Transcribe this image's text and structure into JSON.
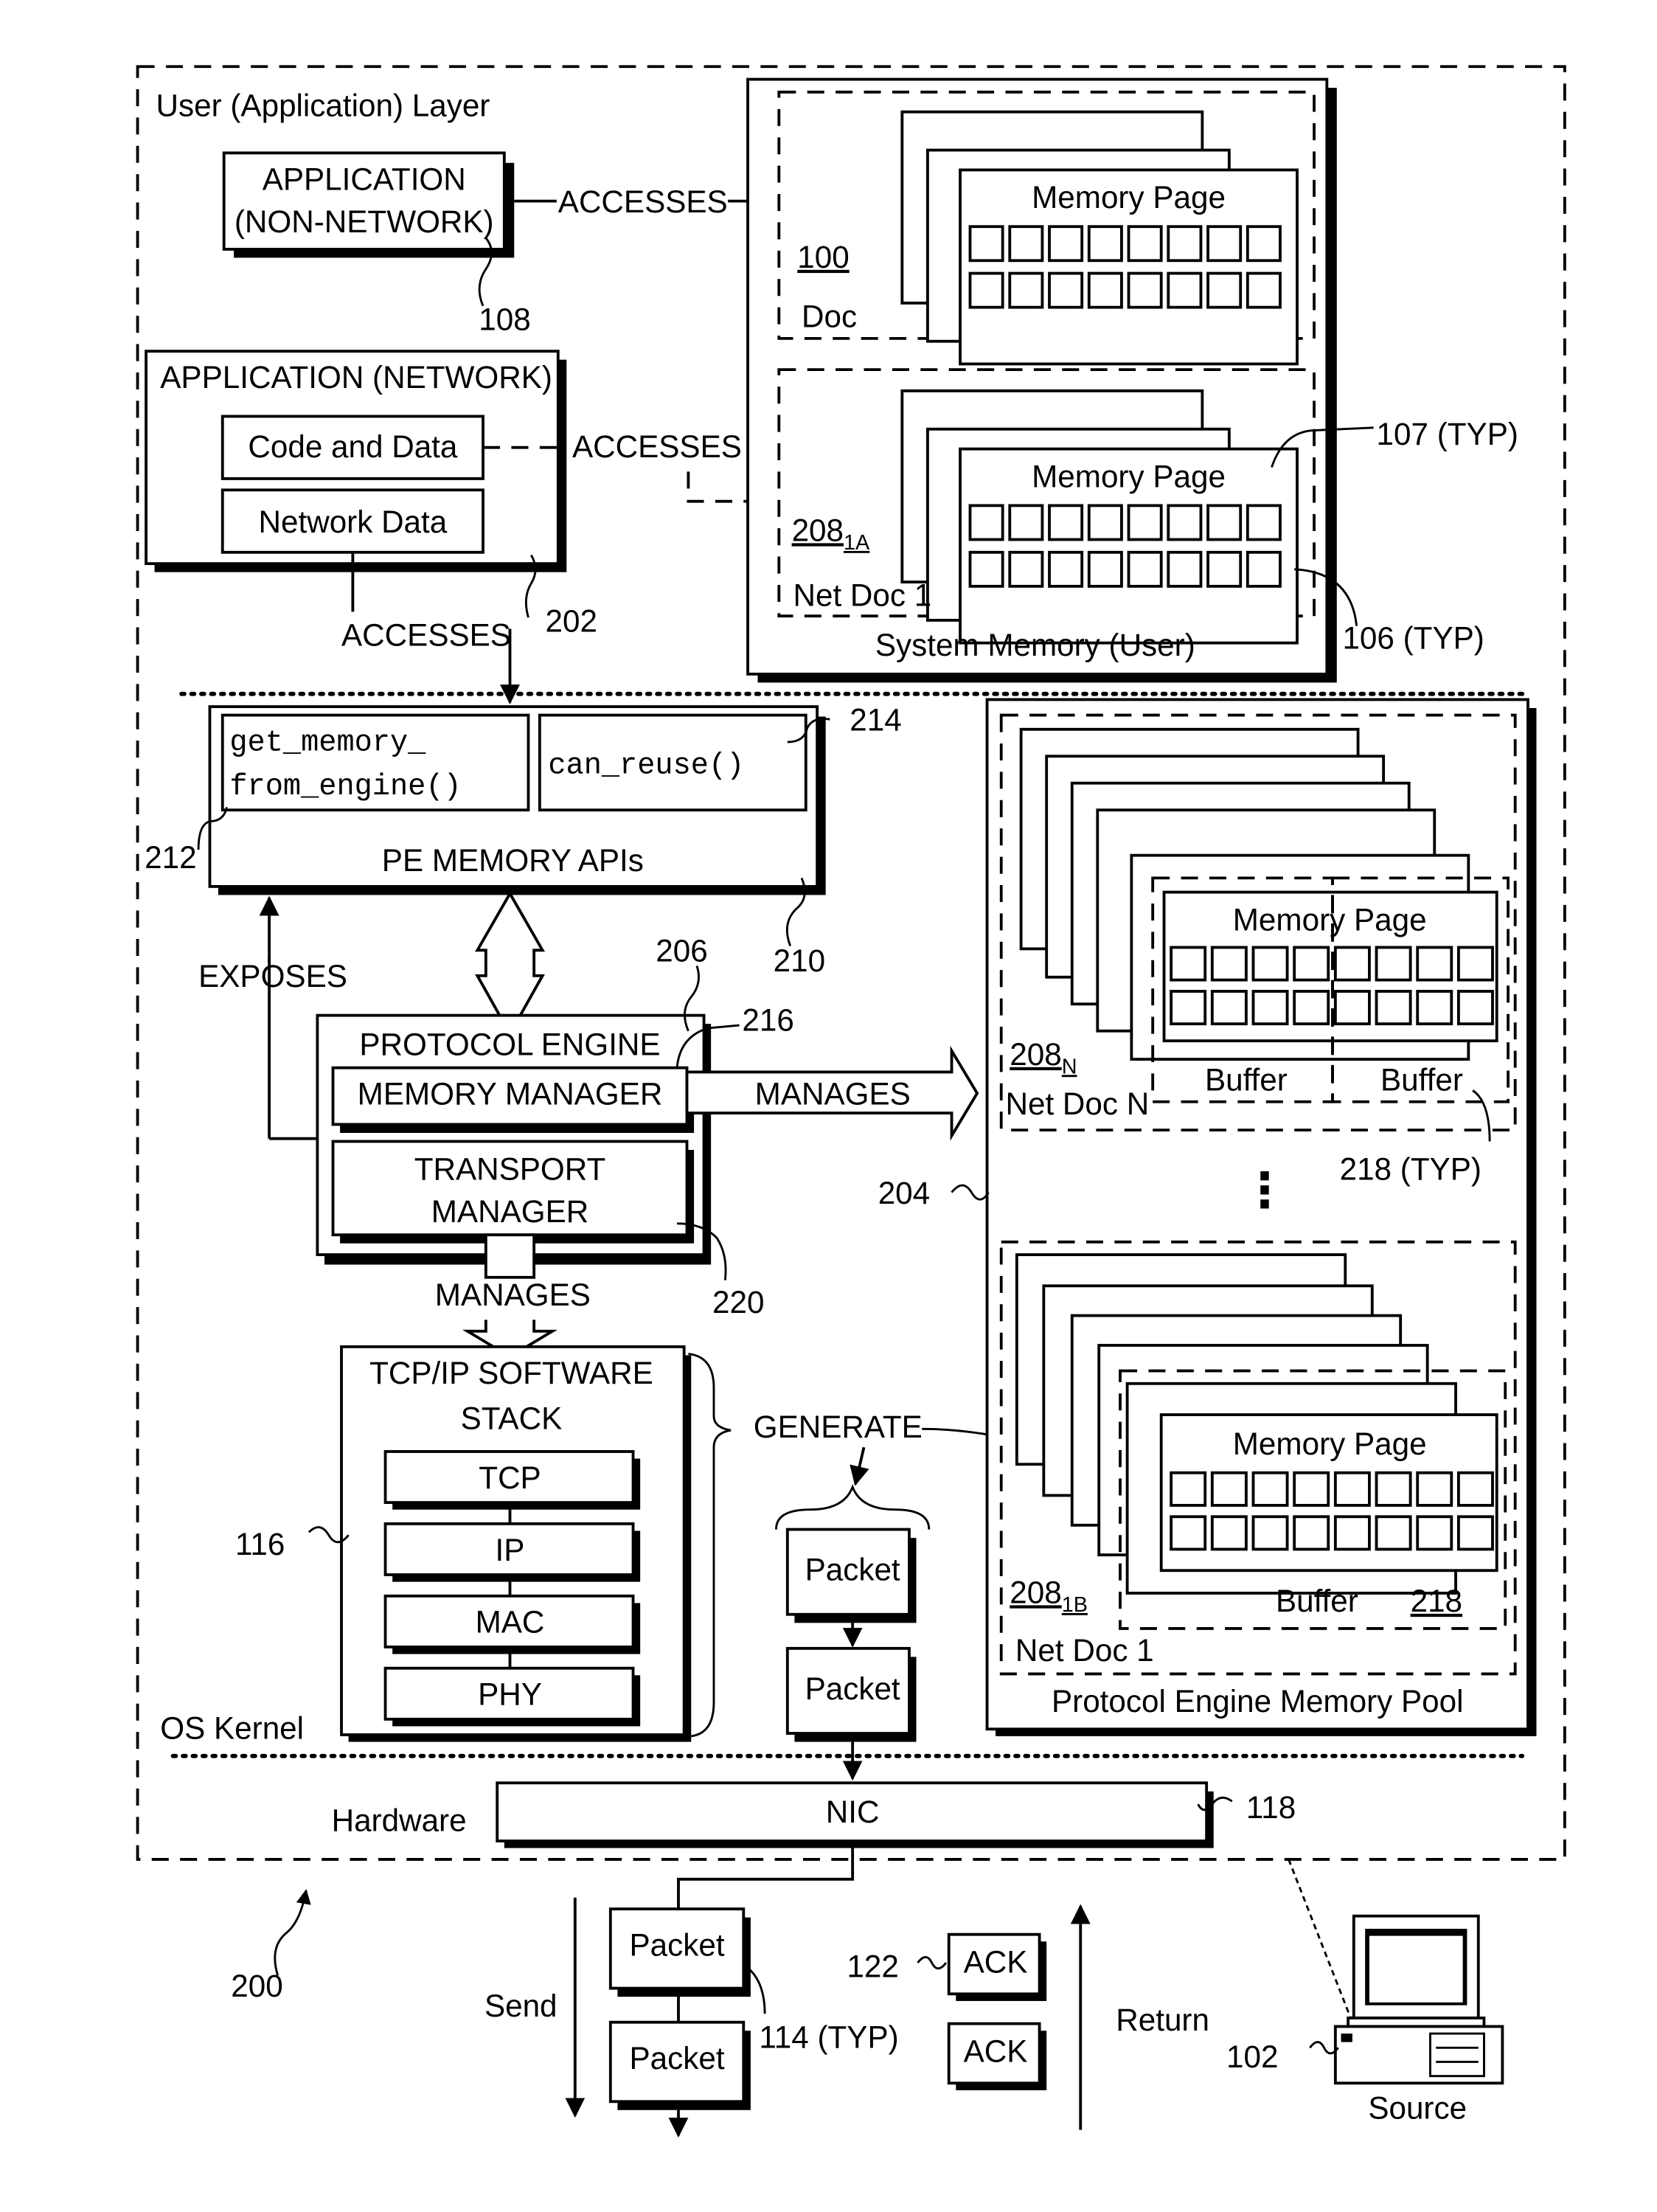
{
  "figure_ref": "200",
  "layers": {
    "user": "User (Application) Layer",
    "kernel": "OS Kernel",
    "hardware": "Hardware"
  },
  "app_non_network": {
    "line1": "APPLICATION",
    "line2": "(NON-NETWORK)",
    "ref": "108"
  },
  "app_network": {
    "title": "APPLICATION (NETWORK)",
    "code_data": "Code and Data",
    "network_data": "Network Data",
    "ref": "202"
  },
  "edges": {
    "accesses_1": "ACCESSES",
    "accesses_2": "ACCESSES",
    "accesses_3": "ACCESSES",
    "exposes": "EXPOSES",
    "manages_memory": "MANAGES",
    "manages_transport": "MANAGES",
    "generate": "GENERATE"
  },
  "system_memory": {
    "caption": "System Memory (User)",
    "memory_page_label": "Memory Page",
    "doc": {
      "ref": "100",
      "name": "Doc"
    },
    "net_doc": {
      "ref": "208",
      "sub": "1A",
      "name": "Net Doc 1"
    },
    "ref_page": "107 (TYP)",
    "ref_cell": "106 (TYP)"
  },
  "pe_apis": {
    "title": "PE MEMORY APIs",
    "api1_line1": "get_memory_",
    "api1_line2": "from_engine()",
    "api2": "can_reuse()",
    "ref_box": "210",
    "ref_api1": "212",
    "ref_api2": "214"
  },
  "protocol_engine": {
    "title": "PROTOCOL ENGINE",
    "memory_manager": "MEMORY MANAGER",
    "transport_line1": "TRANSPORT",
    "transport_line2": "MANAGER",
    "ref_engine": "206",
    "ref_mm": "216",
    "ref_tm": "220"
  },
  "tcpip": {
    "title_line1": "TCP/IP SOFTWARE",
    "title_line2": "STACK",
    "layers": [
      "TCP",
      "IP",
      "MAC",
      "PHY"
    ],
    "ref": "116"
  },
  "generated_packets": [
    "Packet",
    "Packet"
  ],
  "pool": {
    "caption": "Protocol Engine Memory Pool",
    "ref": "204",
    "memory_page_label": "Memory Page",
    "net_doc_n": {
      "ref": "208",
      "sub": "N",
      "name": "Net Doc N",
      "buffers": [
        "Buffer",
        "Buffer"
      ]
    },
    "net_doc_1": {
      "ref": "208",
      "sub": "1B",
      "name": "Net Doc 1",
      "buffer": "Buffer",
      "buffer_ref": "218"
    },
    "ellipsis": "⋮",
    "ref_buffer": "218 (TYP)"
  },
  "nic": {
    "label": "NIC",
    "ref": "118"
  },
  "network": {
    "send": "Send",
    "return": "Return",
    "packets": [
      "Packet",
      "Packet"
    ],
    "packet_ref": "114 (TYP)",
    "acks": [
      "ACK",
      "ACK"
    ],
    "ack_ref": "122",
    "source": "Source",
    "source_ref": "102"
  }
}
